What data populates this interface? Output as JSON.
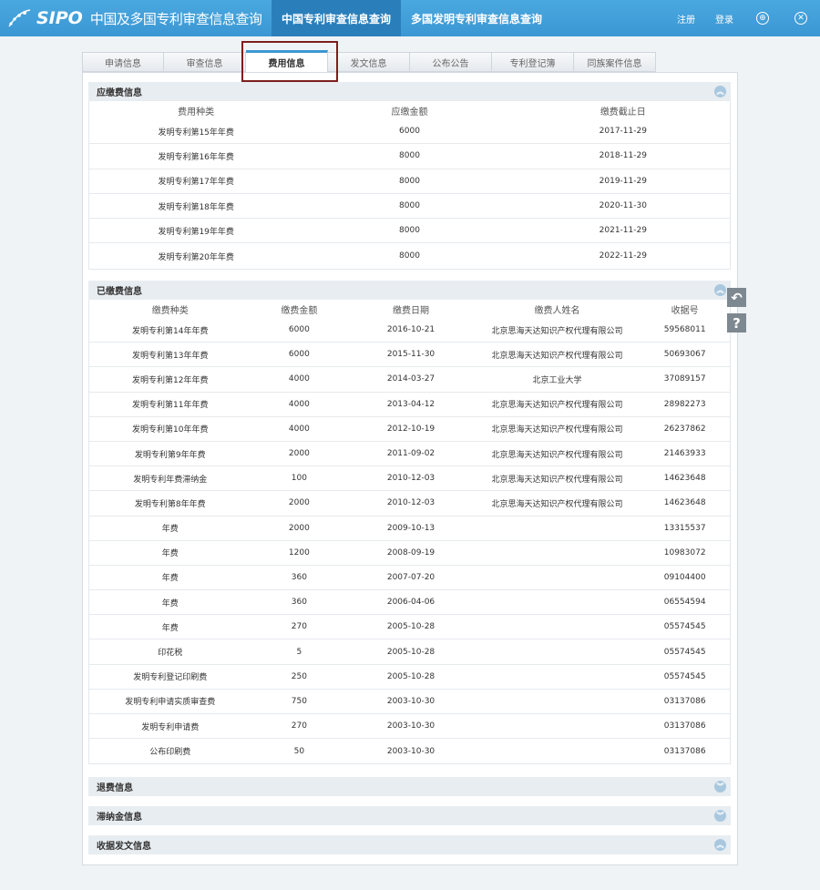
{
  "header": {
    "brand": "SIPO",
    "title": "中国及多国专利审查信息查询",
    "nav": [
      "中国专利审查信息查询",
      "多国发明专利审查信息查询"
    ],
    "register": "注册",
    "login": "登录"
  },
  "tabs": [
    "申请信息",
    "审查信息",
    "费用信息",
    "发文信息",
    "公布公告",
    "专利登记簿",
    "同族案件信息"
  ],
  "due_fees": {
    "title": "应缴费信息",
    "columns": [
      "费用种类",
      "应缴金额",
      "缴费截止日"
    ],
    "rows": [
      [
        "发明专利第15年年费",
        "6000",
        "2017-11-29"
      ],
      [
        "发明专利第16年年费",
        "8000",
        "2018-11-29"
      ],
      [
        "发明专利第17年年费",
        "8000",
        "2019-11-29"
      ],
      [
        "发明专利第18年年费",
        "8000",
        "2020-11-30"
      ],
      [
        "发明专利第19年年费",
        "8000",
        "2021-11-29"
      ],
      [
        "发明专利第20年年费",
        "8000",
        "2022-11-29"
      ]
    ]
  },
  "paid_fees": {
    "title": "已缴费信息",
    "columns": [
      "缴费种类",
      "缴费金额",
      "缴费日期",
      "缴费人姓名",
      "收据号"
    ],
    "rows": [
      [
        "发明专利第14年年费",
        "6000",
        "2016-10-21",
        "北京思海天达知识产权代理有限公司",
        "59568011"
      ],
      [
        "发明专利第13年年费",
        "6000",
        "2015-11-30",
        "北京思海天达知识产权代理有限公司",
        "50693067"
      ],
      [
        "发明专利第12年年费",
        "4000",
        "2014-03-27",
        "北京工业大学",
        "37089157"
      ],
      [
        "发明专利第11年年费",
        "4000",
        "2013-04-12",
        "北京思海天达知识产权代理有限公司",
        "28982273"
      ],
      [
        "发明专利第10年年费",
        "4000",
        "2012-10-19",
        "北京思海天达知识产权代理有限公司",
        "26237862"
      ],
      [
        "发明专利第9年年费",
        "2000",
        "2011-09-02",
        "北京思海天达知识产权代理有限公司",
        "21463933"
      ],
      [
        "发明专利年费滞纳金",
        "100",
        "2010-12-03",
        "北京思海天达知识产权代理有限公司",
        "14623648"
      ],
      [
        "发明专利第8年年费",
        "2000",
        "2010-12-03",
        "北京思海天达知识产权代理有限公司",
        "14623648"
      ],
      [
        "年费",
        "2000",
        "2009-10-13",
        "",
        "13315537"
      ],
      [
        "年费",
        "1200",
        "2008-09-19",
        "",
        "10983072"
      ],
      [
        "年费",
        "360",
        "2007-07-20",
        "",
        "09104400"
      ],
      [
        "年费",
        "360",
        "2006-04-06",
        "",
        "06554594"
      ],
      [
        "年费",
        "270",
        "2005-10-28",
        "",
        "05574545"
      ],
      [
        "印花税",
        "5",
        "2005-10-28",
        "",
        "05574545"
      ],
      [
        "发明专利登记印刷费",
        "250",
        "2005-10-28",
        "",
        "05574545"
      ],
      [
        "发明专利申请实质审查费",
        "750",
        "2003-10-30",
        "",
        "03137086"
      ],
      [
        "发明专利申请费",
        "270",
        "2003-10-30",
        "",
        "03137086"
      ],
      [
        "公布印刷费",
        "50",
        "2003-10-30",
        "",
        "03137086"
      ]
    ]
  },
  "sections": {
    "refund": "退费信息",
    "late_fee": "滞纳金信息",
    "receipt": "收据发文信息"
  },
  "icons": {
    "collapse_up": "chevron-up-icon",
    "expand_down": "chevron-down-icon",
    "back": "back-arrow-icon",
    "help": "help-icon",
    "globe": "globe-icon",
    "close": "close-icon"
  },
  "colors": {
    "header": "#3b97d3",
    "header_active": "#2a7fbb",
    "highlight_box": "#7d1e1e"
  }
}
